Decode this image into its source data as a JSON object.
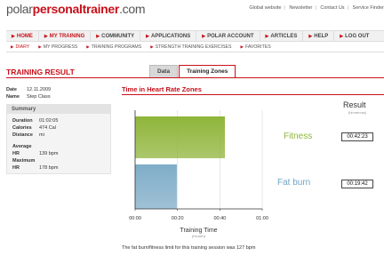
{
  "logo": {
    "part1": "polar",
    "part2": "personaltrainer",
    "part3": ".com"
  },
  "toplinks": [
    "Global website",
    "Newsletter",
    "Contact Us",
    "Service Finder"
  ],
  "mainnav": [
    {
      "label": "HOME",
      "active": true
    },
    {
      "label": "MY TRAINING",
      "active": true
    },
    {
      "label": "COMMUNITY",
      "active": false
    },
    {
      "label": "APPLICATIONS",
      "active": false
    },
    {
      "label": "POLAR ACCOUNT",
      "active": false
    },
    {
      "label": "ARTICLES",
      "active": false
    },
    {
      "label": "HELP",
      "active": false
    },
    {
      "label": "LOG OUT",
      "active": false
    }
  ],
  "subnav": [
    {
      "label": "DIARY",
      "active": true
    },
    {
      "label": "MY PROGRESS",
      "active": false
    },
    {
      "label": "TRAINING PROGRAMS",
      "active": false
    },
    {
      "label": "STRENGTH TRAINING EXERCISES",
      "active": false
    },
    {
      "label": "FAVORITES",
      "active": false
    }
  ],
  "page": {
    "title": "TRAINING RESULT"
  },
  "tabs": [
    {
      "label": "Data",
      "active": false
    },
    {
      "label": "Training Zones",
      "active": true
    }
  ],
  "session": {
    "date_label": "Date",
    "date": "12.11.2009",
    "name_label": "Name",
    "name": "Step Class"
  },
  "summary": {
    "header": "Summary",
    "duration_label": "Duration",
    "duration": "01:02:05",
    "calories_label": "Calories",
    "calories": "474 Cal",
    "distance_label": "Distance",
    "distance": "mi",
    "avg_label": "Average HR",
    "avg": "139 bpm",
    "max_label": "Maximum HR",
    "max": "178 bpm"
  },
  "chart_data": {
    "type": "bar",
    "title": "Time in Heart Rate Zones",
    "orientation": "horizontal",
    "categories": [
      "Fitness",
      "Fat burn"
    ],
    "values_minutes": [
      42.38,
      19.7
    ],
    "value_labels": [
      "00:42:23",
      "00:19:42"
    ],
    "colors": [
      "#8fb53a",
      "#7fadc8"
    ],
    "xticks": [
      "00:00",
      "00:20",
      "00:40",
      "01:00"
    ],
    "xlim_minutes": [
      0,
      60
    ],
    "xlabel": "Training Time",
    "xunit": "(hh:mm)",
    "result_label": "Result",
    "result_unit": "(hh:mm:ss)"
  },
  "footnote": "The fat burn/fitness limit for this training session was 127 bpm"
}
